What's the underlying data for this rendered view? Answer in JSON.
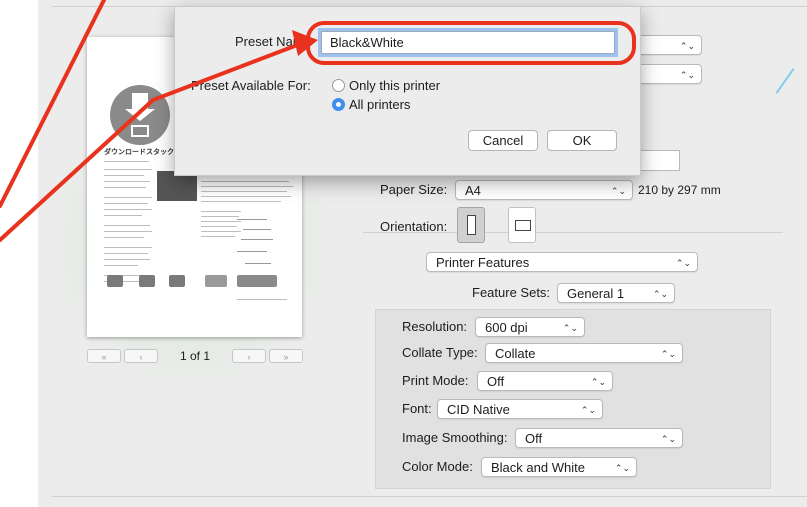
{
  "preview": {
    "page_title": "ダウンロードスタック",
    "page_count": "1 of 1",
    "first_page": "«",
    "prev_page": "‹",
    "next_page": "›",
    "last_page": "»"
  },
  "preset_sheet": {
    "preset_name_label": "Preset Name:",
    "preset_name_value": "Black&White",
    "available_for_label": "Preset Available For:",
    "option_only_printer": "Only this printer",
    "option_all_printers": "All printers",
    "selected_option": "All printers",
    "cancel_label": "Cancel",
    "ok_label": "OK"
  },
  "print_settings": {
    "paper_size_label": "Paper Size:",
    "paper_size_value": "A4",
    "paper_dims": "210 by 297 mm",
    "orientation_label": "Orientation:",
    "section_popup": "Printer Features",
    "feature_sets_label": "Feature Sets:",
    "feature_sets_value": "General 1"
  },
  "features": {
    "resolution_label": "Resolution:",
    "resolution_value": "600 dpi",
    "collate_type_label": "Collate Type:",
    "collate_type_value": "Collate",
    "print_mode_label": "Print Mode:",
    "print_mode_value": "Off",
    "font_label": "Font:",
    "font_value": "CID Native",
    "image_smoothing_label": "Image Smoothing:",
    "image_smoothing_value": "Off",
    "color_mode_label": "Color Mode:",
    "color_mode_value": "Black and White"
  },
  "colors": {
    "annotation_red": "#e8321e",
    "focus_ring": "#78a9e8",
    "radio_selected": "#3d8ef0"
  }
}
